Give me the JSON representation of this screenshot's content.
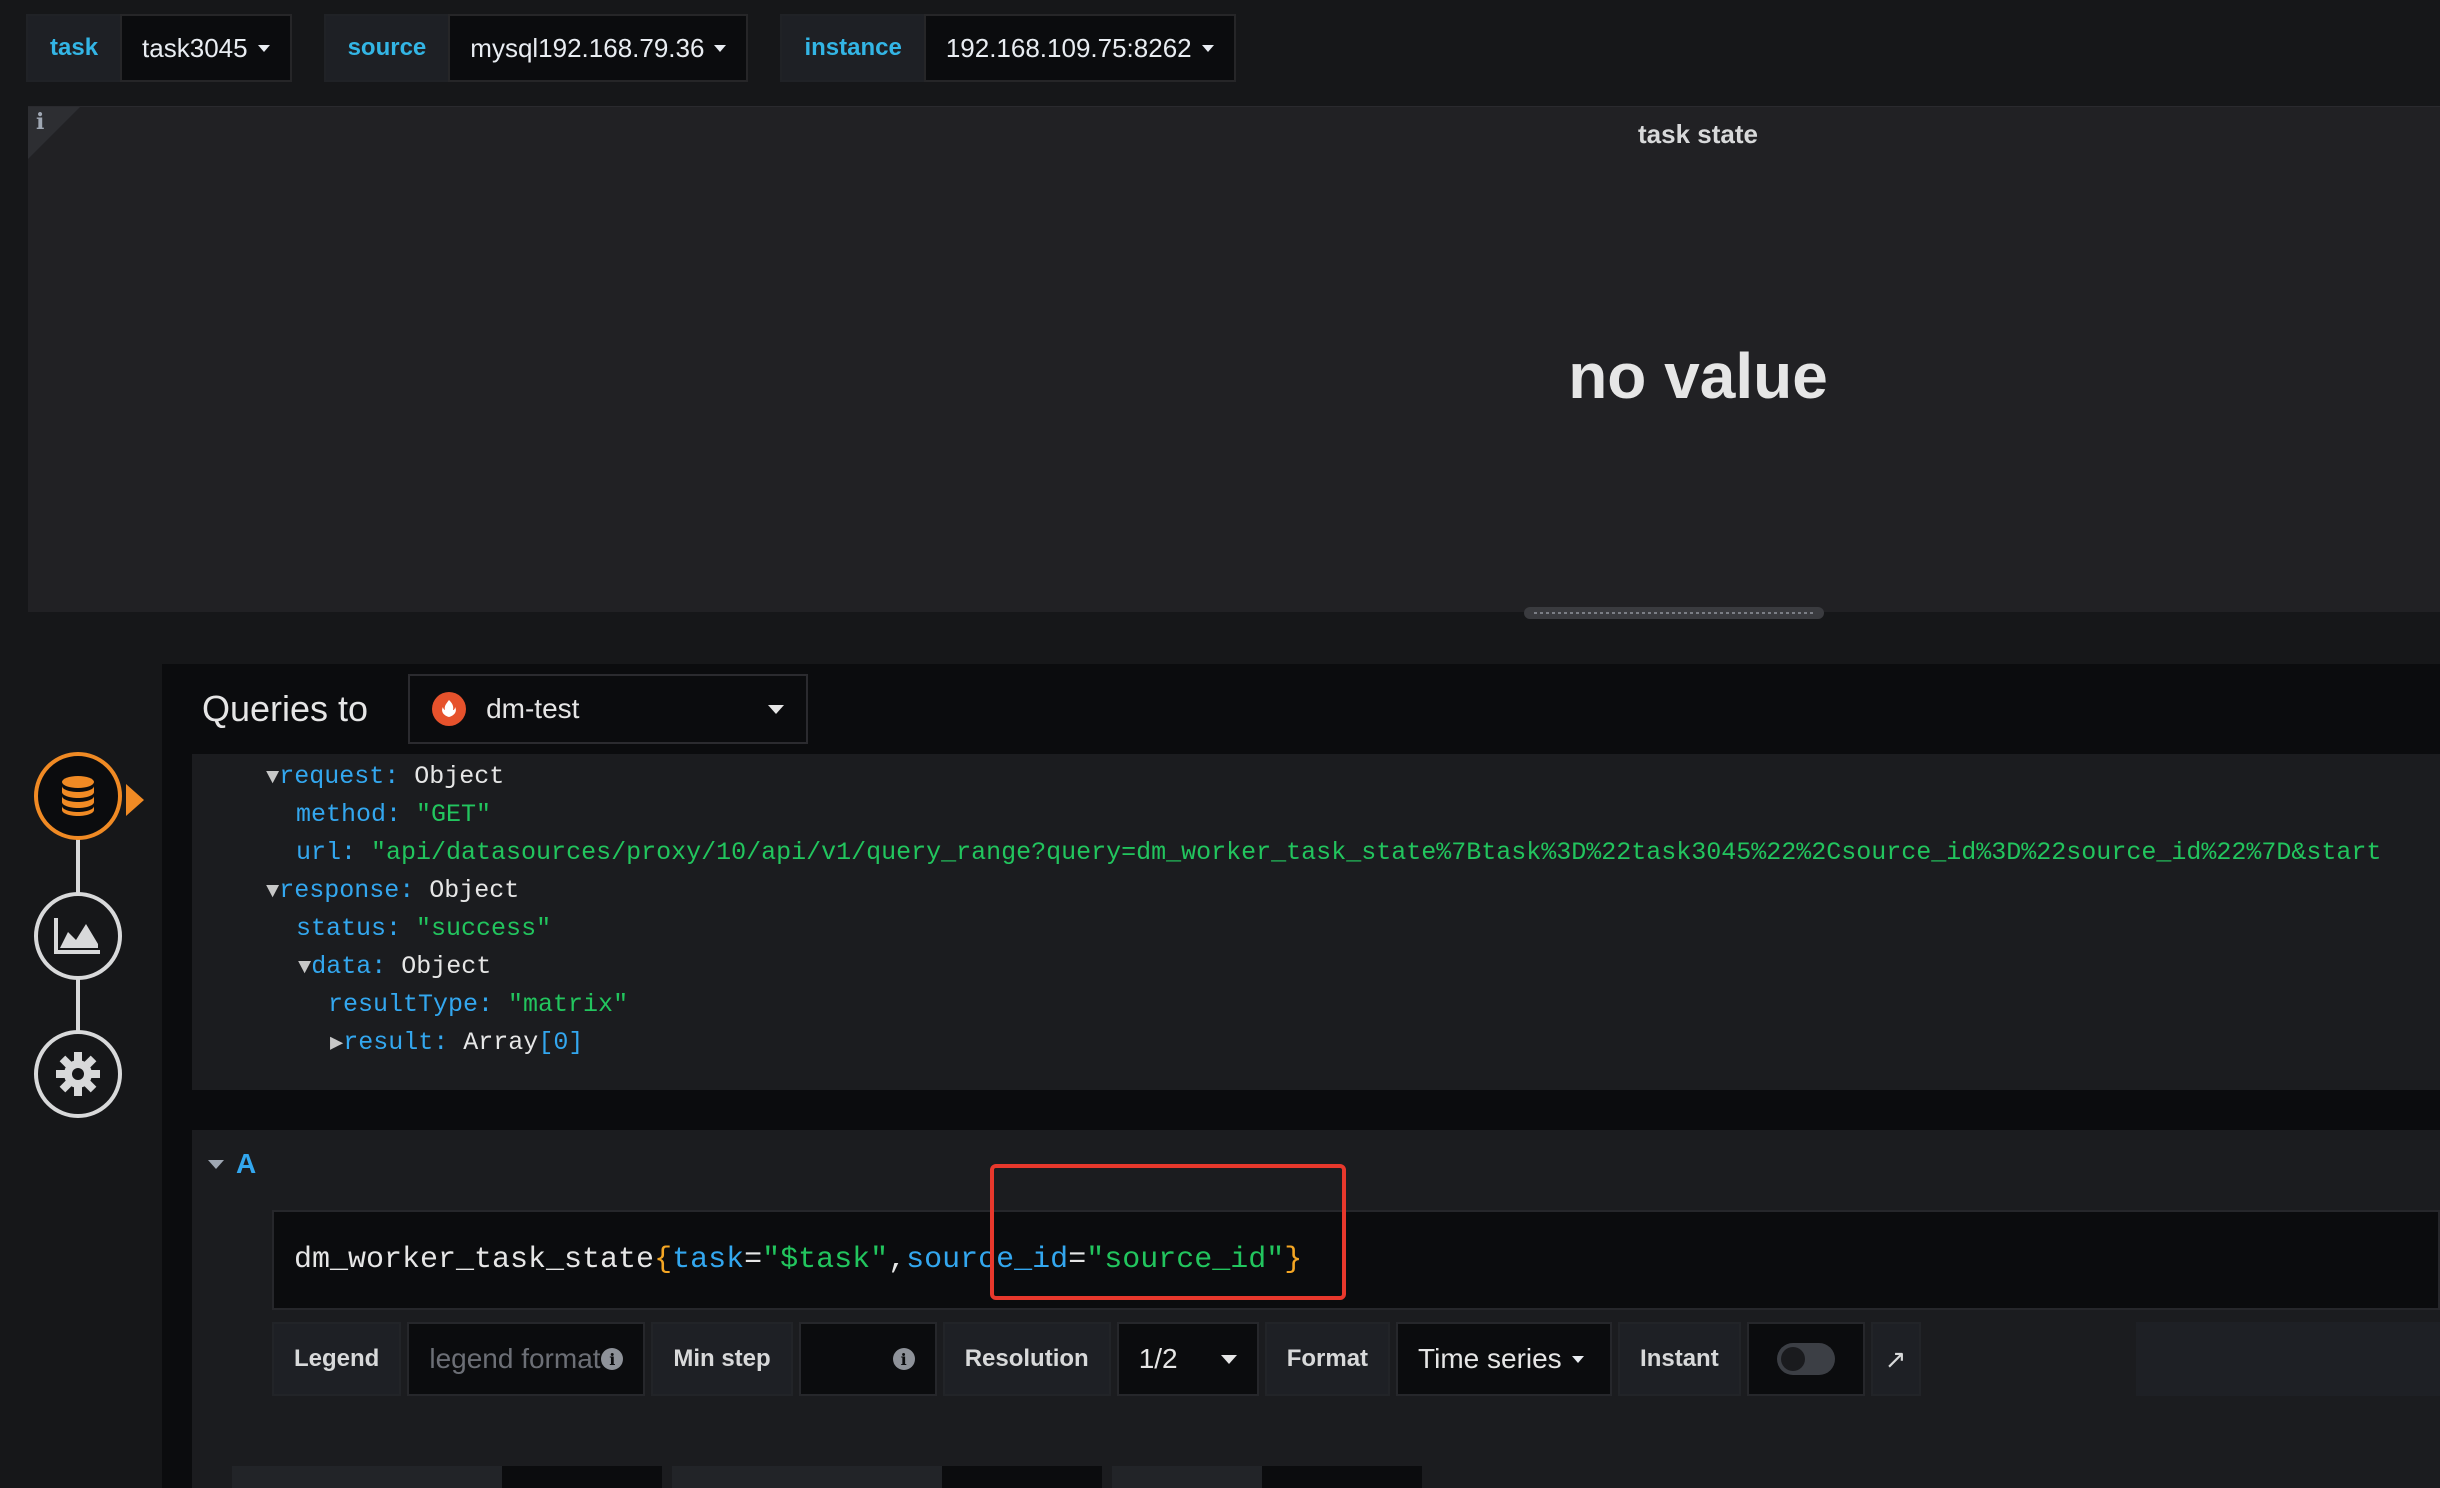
{
  "variables": [
    {
      "label": "task",
      "value": "task3045"
    },
    {
      "label": "source",
      "value": "mysql192.168.79.36"
    },
    {
      "label": "instance",
      "value": "192.168.109.75:8262"
    }
  ],
  "panel": {
    "title": "task state",
    "value_text": "no value",
    "info_icon": "i"
  },
  "editor": {
    "queries_to": "Queries to",
    "datasource": "dm-test",
    "inspector": {
      "request_key": "request:",
      "request_type": "Object",
      "method_key": "method:",
      "method_val": "\"GET\"",
      "url_key": "url:",
      "url_val": "\"api/datasources/proxy/10/api/v1/query_range?query=dm_worker_task_state%7Btask%3D%22task3045%22%2Csource_id%3D%22source_id%22%7D&start",
      "response_key": "response:",
      "response_type": "Object",
      "status_key": "status:",
      "status_val": "\"success\"",
      "data_key": "data:",
      "data_type": "Object",
      "resulttype_key": "resultType:",
      "resulttype_val": "\"matrix\"",
      "result_key": "result:",
      "result_type": "Array",
      "result_len": "[0]"
    },
    "query": {
      "letter": "A",
      "metric": "dm_worker_task_state",
      "brace_open": "{",
      "label1": "task",
      "eq1": "=",
      "val1": "\"$task\"",
      "comma": ",",
      "label2": "source_id",
      "eq2": "=",
      "val2": "\"source_id\"",
      "brace_close": "}"
    },
    "options": {
      "legend_label": "Legend",
      "legend_placeholder": "legend format",
      "min_step_label": "Min step",
      "resolution_label": "Resolution",
      "resolution_value": "1/2",
      "format_label": "Format",
      "format_value": "Time series",
      "instant_label": "Instant"
    }
  },
  "rail": {
    "items": [
      "database-icon",
      "chart-area-icon",
      "gear-icon"
    ],
    "active": "database-icon"
  },
  "colors": {
    "accent": "#33b5e5",
    "rail_active": "#f08a24",
    "highlight": "#e8382c",
    "string": "#22c55e",
    "key": "#33a7ef"
  }
}
